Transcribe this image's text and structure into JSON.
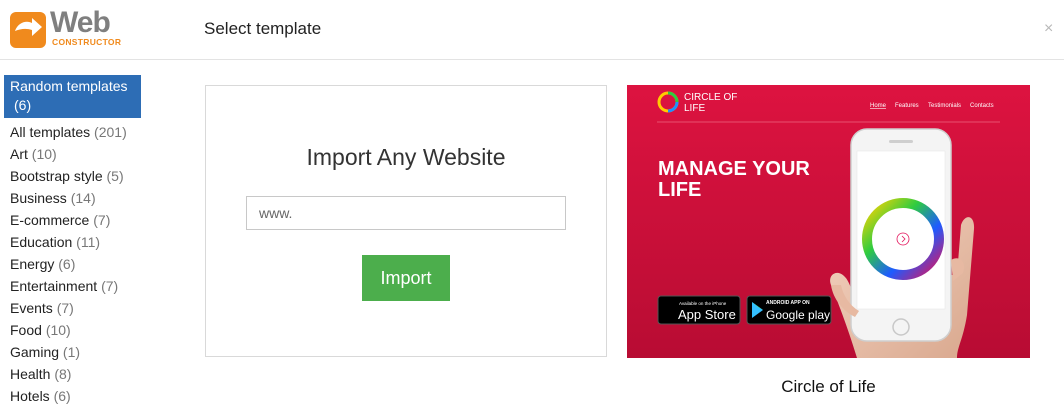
{
  "brand": {
    "name": "Web",
    "sub": "CONSTRUCTOR",
    "accent_color": "#f08a1d"
  },
  "header": {
    "title": "Select template",
    "close_icon": "×"
  },
  "sidebar": {
    "active": {
      "label": "Random templates",
      "count": "(6)"
    },
    "items": [
      {
        "label": "All templates",
        "count": "(201)"
      },
      {
        "label": "Art",
        "count": "(10)"
      },
      {
        "label": "Bootstrap style",
        "count": "(5)"
      },
      {
        "label": "Business",
        "count": "(14)"
      },
      {
        "label": "E-commerce",
        "count": "(7)"
      },
      {
        "label": "Education",
        "count": "(11)"
      },
      {
        "label": "Energy",
        "count": "(6)"
      },
      {
        "label": "Entertainment",
        "count": "(7)"
      },
      {
        "label": "Events",
        "count": "(7)"
      },
      {
        "label": "Food",
        "count": "(10)"
      },
      {
        "label": "Gaming",
        "count": "(1)"
      },
      {
        "label": "Health",
        "count": "(8)"
      },
      {
        "label": "Hotels",
        "count": "(6)"
      }
    ]
  },
  "import": {
    "title": "Import Any Website",
    "placeholder": "www.",
    "button_label": "Import",
    "button_color": "#4cae4c"
  },
  "template": {
    "caption": "Circle of Life",
    "preview": {
      "logo_line1": "CIRCLE OF",
      "logo_line2": "LIFE",
      "nav": [
        "Home",
        "Features",
        "Testimonials",
        "Contacts"
      ],
      "headline_line1": "MANAGE YOUR",
      "headline_line2": "LIFE",
      "appstore_small": "Available on the iPhone",
      "appstore_big": "App Store",
      "gplay_small": "ANDROID APP ON",
      "gplay_big": "Google play",
      "bg_color": "#d4123a"
    }
  }
}
